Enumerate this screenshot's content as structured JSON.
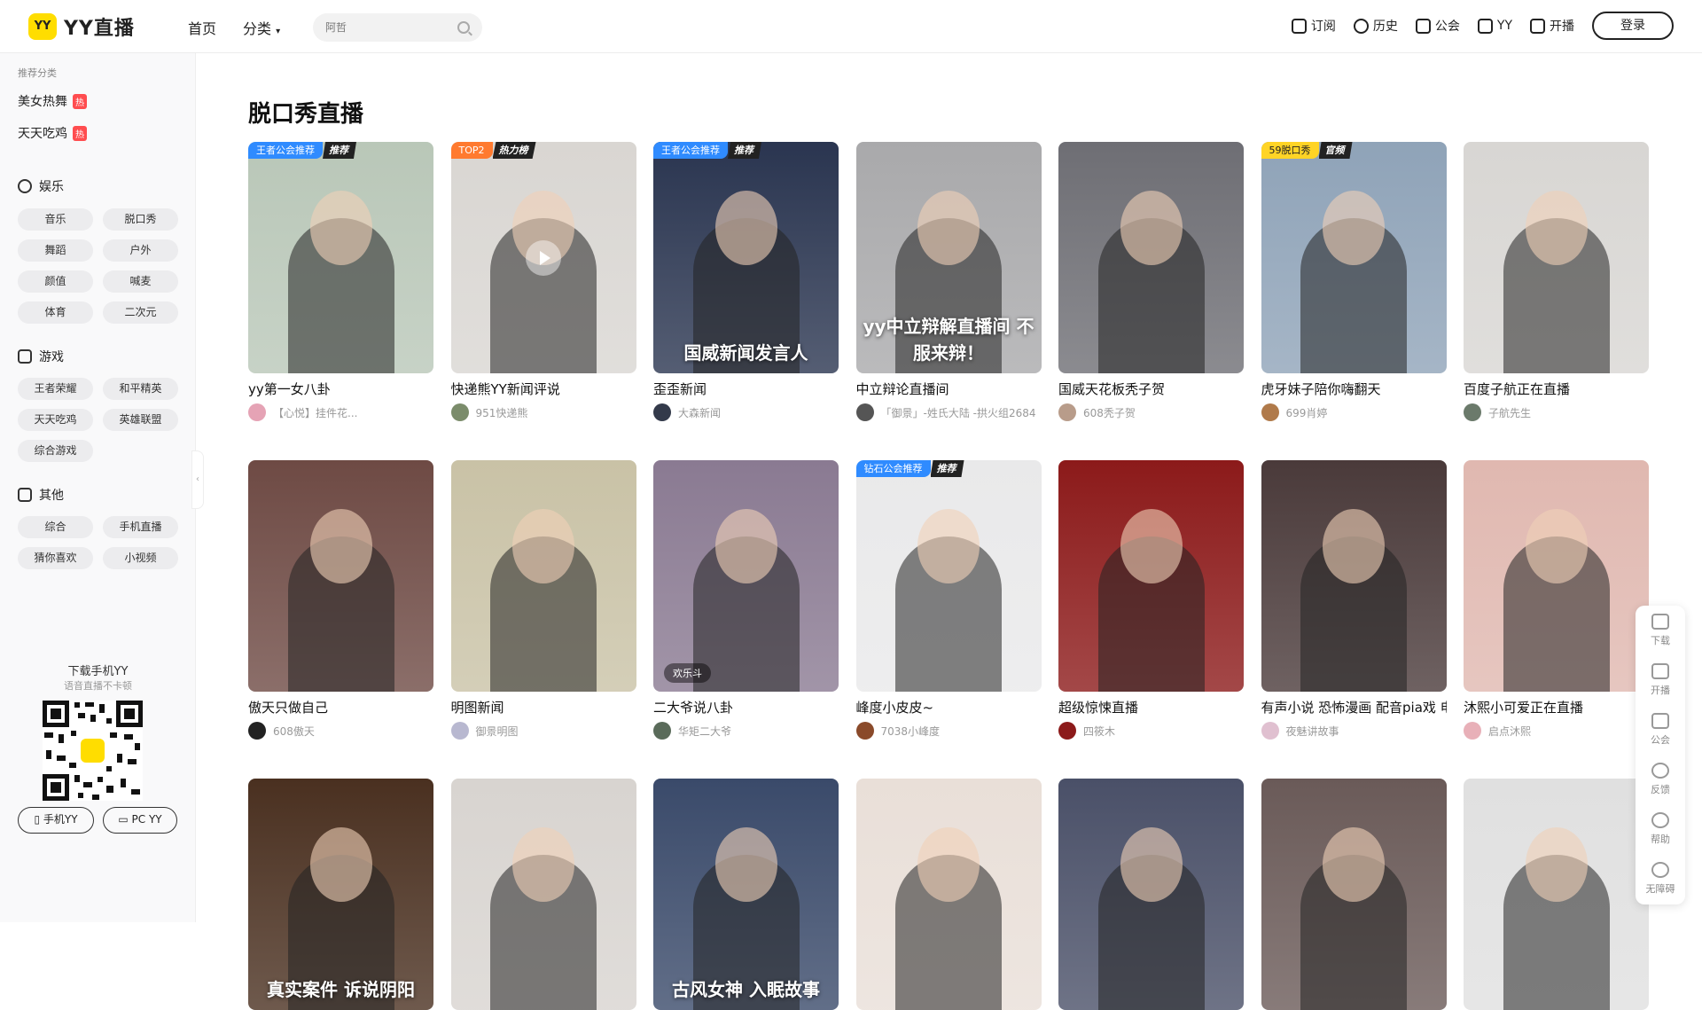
{
  "header": {
    "logo_badge": "YY",
    "logo_text": "YY直播",
    "nav": [
      "首页",
      "分类"
    ],
    "search_placeholder": "阿哲",
    "right_items": [
      "订阅",
      "历史",
      "公会",
      "YY",
      "开播"
    ],
    "login": "登录"
  },
  "sidebar": {
    "caption": "推荐分类",
    "hot_items": [
      {
        "label": "美女热舞",
        "badge": "热"
      },
      {
        "label": "天天吃鸡",
        "badge": "热"
      }
    ],
    "groups": [
      {
        "label": "娱乐",
        "tags": [
          "音乐",
          "脱口秀",
          "舞蹈",
          "户外",
          "颜值",
          "喊麦",
          "体育",
          "二次元"
        ]
      },
      {
        "label": "游戏",
        "tags": [
          "王者荣耀",
          "和平精英",
          "天天吃鸡",
          "英雄联盟",
          "综合游戏"
        ]
      },
      {
        "label": "其他",
        "tags": [
          "综合",
          "手机直播",
          "猜你喜欢",
          "小视频"
        ]
      }
    ],
    "qr_label": "下载手机YY",
    "qr_sub": "语音直播不卡顿",
    "btn_mobile": "手机YY",
    "btn_pc": "PC YY"
  },
  "main": {
    "title": "脱口秀直播",
    "cards": [
      {
        "title": "yy第一女八卦",
        "anchor": "【心悦】挂件花...",
        "badge1": "王者公会推荐",
        "badge2": "推荐",
        "bg": "#b9c7b8",
        "avatar": "#e5a3b5"
      },
      {
        "title": "快递熊YY新闻评说",
        "anchor": "951快递熊",
        "badge1": "TOP2",
        "badge2": "热力榜",
        "bg": "#d9d6d2",
        "avatar": "#7b8c6b"
      },
      {
        "title": "歪歪新闻",
        "anchor": "大森新闻",
        "badge1": "王者公会推荐",
        "badge2": "推荐",
        "bg": "#2a3550",
        "avatar": "#333a4a",
        "overlay": "国威新闻发言人"
      },
      {
        "title": "中立辩论直播间",
        "anchor": "「御景」-姓氏大陆 -拱火组2684",
        "bg": "#a9a9ab",
        "avatar": "#555",
        "overlay": "yy中立辩解直播间 不服来辩！"
      },
      {
        "title": "国威天花板秃子贺",
        "anchor": "608秃子贺",
        "bg": "#6e6e74",
        "avatar": "#b89c8a"
      },
      {
        "title": "虎牙妹子陪你嗨翻天",
        "anchor": "699肖婷",
        "badge1": "59脱口秀",
        "badge2": "官频",
        "bg": "#8fa3b8",
        "avatar": "#b07a4a"
      },
      {
        "title": "百度子航正在直播",
        "anchor": "子航先生",
        "bg": "#d8d6d3",
        "avatar": "#6b7a6b"
      },
      {
        "title": "傲天只做自己",
        "anchor": "608傲天",
        "bg": "#6e4a44",
        "avatar": "#222"
      },
      {
        "title": "明图新闻",
        "anchor": "御景明图",
        "bg": "#c9c2a6",
        "avatar": "#b8b8d0"
      },
      {
        "title": "二大爷说八卦",
        "anchor": "华矩二大爷",
        "bg": "#8a7a92",
        "avatar": "#5a6b5a",
        "pill": "欢乐斗"
      },
      {
        "title": "峰度小皮皮~",
        "anchor": "7038小峰度",
        "badge1": "钻石公会推荐",
        "badge2": "推荐",
        "bg": "#e9e9ea",
        "avatar": "#8a4a2a"
      },
      {
        "title": "超级惊悚直播",
        "anchor": "四筱木",
        "bg": "#8c1a1a",
        "avatar": "#8c1a1a"
      },
      {
        "title": "有声小说 恐怖漫画 配音pia戏 电",
        "anchor": "夜魅讲故事",
        "bg": "#4a3a3a",
        "avatar": "#e0c0d0"
      },
      {
        "title": "沐熙小可爱正在直播",
        "anchor": "启点沐熙",
        "bg": "#e0b8b0",
        "avatar": "#e8b0b8"
      },
      {
        "title": "",
        "anchor": "",
        "bg": "#4a3020",
        "overlay": "真实案件 诉说阴阳"
      },
      {
        "title": "",
        "anchor": "",
        "bg": "#d8d4d0"
      },
      {
        "title": "",
        "anchor": "",
        "bg": "#3a4a6a",
        "overlay": "古风女神 入眠故事"
      },
      {
        "title": "",
        "anchor": "",
        "bg": "#e9dfd8"
      },
      {
        "title": "",
        "anchor": "",
        "bg": "#4a5068"
      },
      {
        "title": "",
        "anchor": "",
        "bg": "#6a5a58"
      },
      {
        "title": "",
        "anchor": "",
        "bg": "#e0e0e0"
      }
    ]
  },
  "floatbar": [
    "下载",
    "开播",
    "公会",
    "反馈",
    "帮助",
    "无障碍"
  ],
  "colors": {
    "brand_yellow": "#ffdd00",
    "badge_blue": "#2f8bff",
    "badge_orange": "#ff7a2f",
    "badge_gold": "#ffd426",
    "hot_red": "#ff4d4f"
  }
}
